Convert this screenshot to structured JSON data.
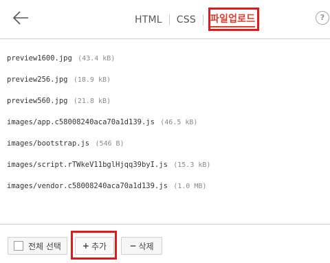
{
  "header": {
    "back_icon": "arrow-left-icon",
    "tabs": [
      {
        "label": "HTML",
        "active": false
      },
      {
        "label": "CSS",
        "active": false
      },
      {
        "label": "파일업로드",
        "active": true
      }
    ],
    "help_label": "?"
  },
  "files": [
    {
      "name": "preview1600.jpg",
      "size": "(43.4 kB)"
    },
    {
      "name": "preview256.jpg",
      "size": "(18.9 kB)"
    },
    {
      "name": "preview560.jpg",
      "size": "(21.8 kB)"
    },
    {
      "name": "images/app.c58008240aca70a1d139.js",
      "size": "(46.5 kB)"
    },
    {
      "name": "images/bootstrap.js",
      "size": "(546 B)"
    },
    {
      "name": "images/script.rTWkeV11bglHjqq39byI.js",
      "size": "(15.3 kB)"
    },
    {
      "name": "images/vendor.c58008240aca70a1d139.js",
      "size": "(1.0 MB)"
    }
  ],
  "footer": {
    "select_all_label": "전체 선택",
    "add_symbol": "+",
    "add_label": "추가",
    "delete_symbol": "−",
    "delete_label": "삭제"
  },
  "colors": {
    "accent": "#e2372b",
    "highlight_box": "#e31919"
  }
}
